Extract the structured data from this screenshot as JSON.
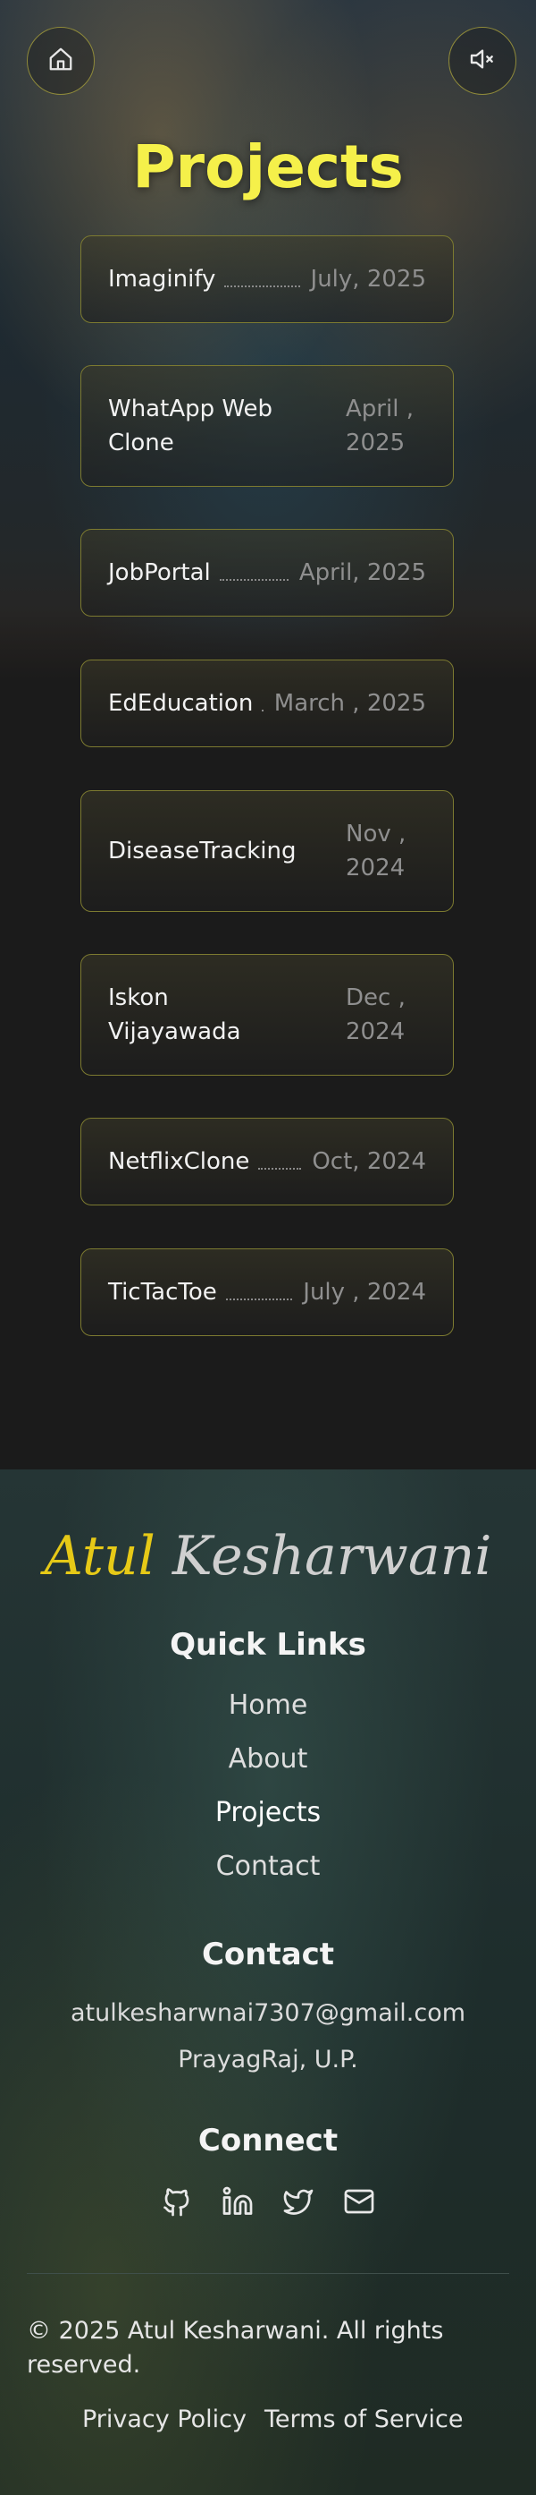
{
  "header": {
    "title": "Projects"
  },
  "projects": [
    {
      "name": "Imaginify",
      "date": "July, 2025"
    },
    {
      "name": "WhatApp Web Clone",
      "date": "April , 2025"
    },
    {
      "name": "JobPortal",
      "date": "April, 2025"
    },
    {
      "name": "EdEducation",
      "date": "March , 2025"
    },
    {
      "name": "DiseaseTracking",
      "date": "Nov , 2024"
    },
    {
      "name": "Iskon Vijayawada",
      "date": "Dec , 2024"
    },
    {
      "name": "NetflixClone",
      "date": "Oct, 2024"
    },
    {
      "name": "TicTacToe",
      "date": "July , 2024"
    }
  ],
  "footer": {
    "brand_first": "Atul",
    "brand_last": "Kesharwani",
    "quick_links_title": "Quick Links",
    "links": [
      "Home",
      "About",
      "Projects",
      "Contact"
    ],
    "contact_title": "Contact",
    "email": "atulkesharwnai7307@gmail.com",
    "location": "PrayagRaj, U.P.",
    "connect_title": "Connect",
    "copyright": "© 2025 Atul Kesharwani. All rights reserved.",
    "privacy": "Privacy Policy",
    "terms": "Terms of Service"
  },
  "colors": {
    "accent_yellow": "#f5f04a",
    "card_border": "#7c7a30",
    "background": "#1b1b1b"
  }
}
